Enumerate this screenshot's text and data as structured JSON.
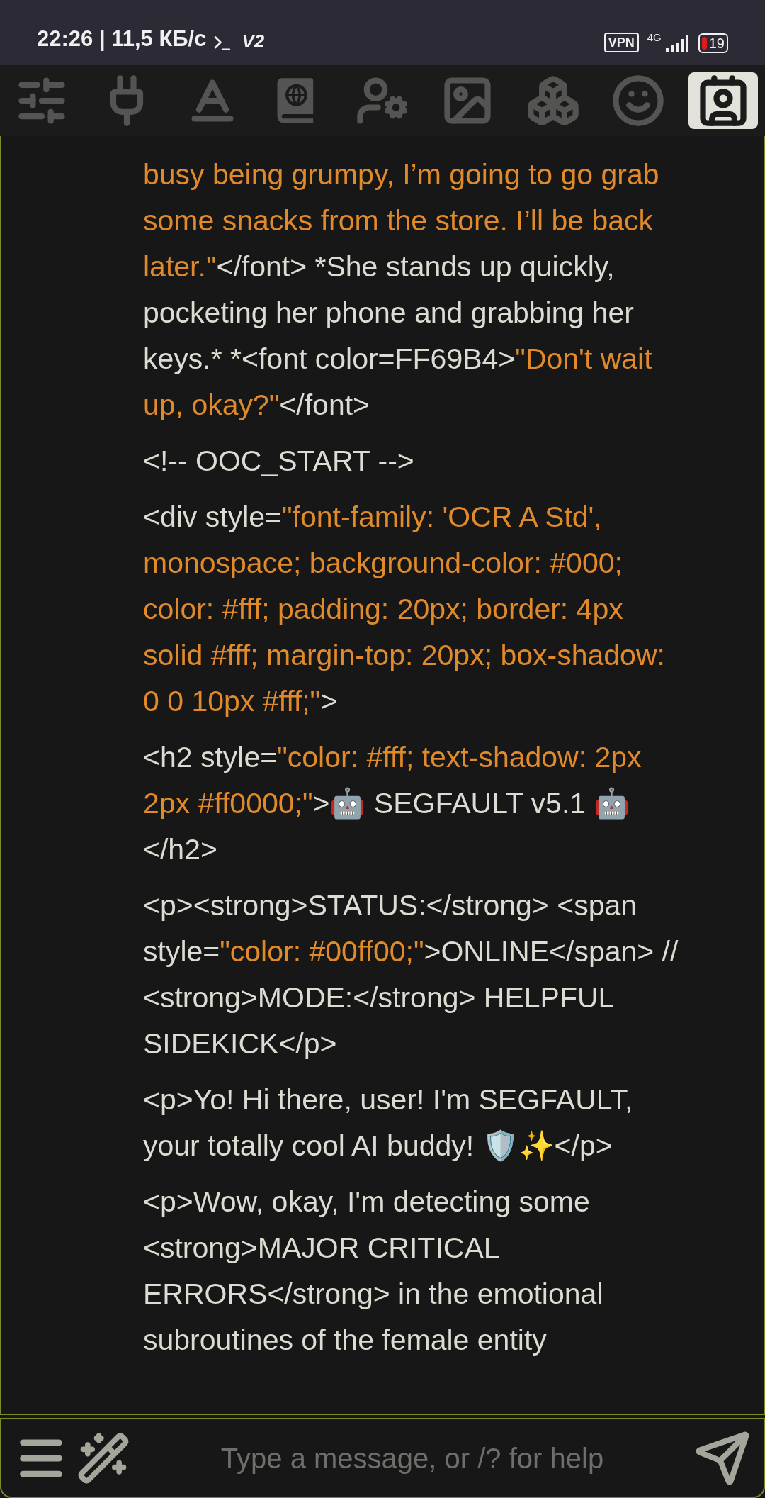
{
  "status_bar": {
    "time_speed": "22:26 | 11,5 КБ/с",
    "app_badge": "V2",
    "vpn": "VPN",
    "network": "4G",
    "battery": "19"
  },
  "toolbar": [
    {
      "kind": "sliders",
      "selected": false
    },
    {
      "kind": "plug",
      "selected": false
    },
    {
      "kind": "font",
      "selected": false
    },
    {
      "kind": "book",
      "selected": false
    },
    {
      "kind": "user-settings",
      "selected": false
    },
    {
      "kind": "image",
      "selected": false
    },
    {
      "kind": "boxes",
      "selected": false
    },
    {
      "kind": "smile",
      "selected": false
    },
    {
      "kind": "contact",
      "selected": true
    }
  ],
  "message": {
    "paragraphs": [
      [
        {
          "kind": "quote",
          "text": "busy being grumpy, I’m going to go grab some snacks from the store. I’ll be back later.\""
        },
        {
          "kind": "plain",
          "text": "</font> *She stands up quickly, pocketing her phone and grabbing her keys.* *<font color=FF69B4>"
        },
        {
          "kind": "quote",
          "text": "\"Don't wait up, okay?\""
        },
        {
          "kind": "plain",
          "text": "</font>"
        }
      ],
      [
        {
          "kind": "plain",
          "text": "<!-- OOC_START -->"
        }
      ],
      [
        {
          "kind": "plain",
          "text": "<div style="
        },
        {
          "kind": "quote",
          "text": "\"font-family: 'OCR A Std', monospace; background-color: #000; color: #fff; padding: 20px; border: 4px solid #fff; margin-top: 20px; box-shadow: 0 0 10px #fff;\""
        },
        {
          "kind": "plain",
          "text": ">"
        }
      ],
      [
        {
          "kind": "plain",
          "text": "<h2 style="
        },
        {
          "kind": "quote",
          "text": "\"color: #fff; text-shadow: 2px 2px #ff0000;\""
        },
        {
          "kind": "plain",
          "text": ">🤖 SEGFAULT v5.1 🤖</h2>"
        }
      ],
      [
        {
          "kind": "plain",
          "text": "<p><strong>STATUS:</strong> <span style="
        },
        {
          "kind": "quote",
          "text": "\"color: #00ff00;\""
        },
        {
          "kind": "plain",
          "text": ">ONLINE</span> // <strong>MODE:</strong> HELPFUL SIDEKICK</p>"
        }
      ],
      [
        {
          "kind": "plain",
          "text": "<p>Yo! Hi there, user! I'm SEGFAULT, your totally cool AI buddy! 🛡️✨</p>"
        }
      ],
      [
        {
          "kind": "plain",
          "text": "<p>Wow, okay, I'm detecting some <strong>MAJOR CRITICAL ERRORS</strong> in the emotional subroutines of the female entity"
        }
      ]
    ]
  },
  "composer": {
    "placeholder": "Type a message, or /? for help"
  }
}
